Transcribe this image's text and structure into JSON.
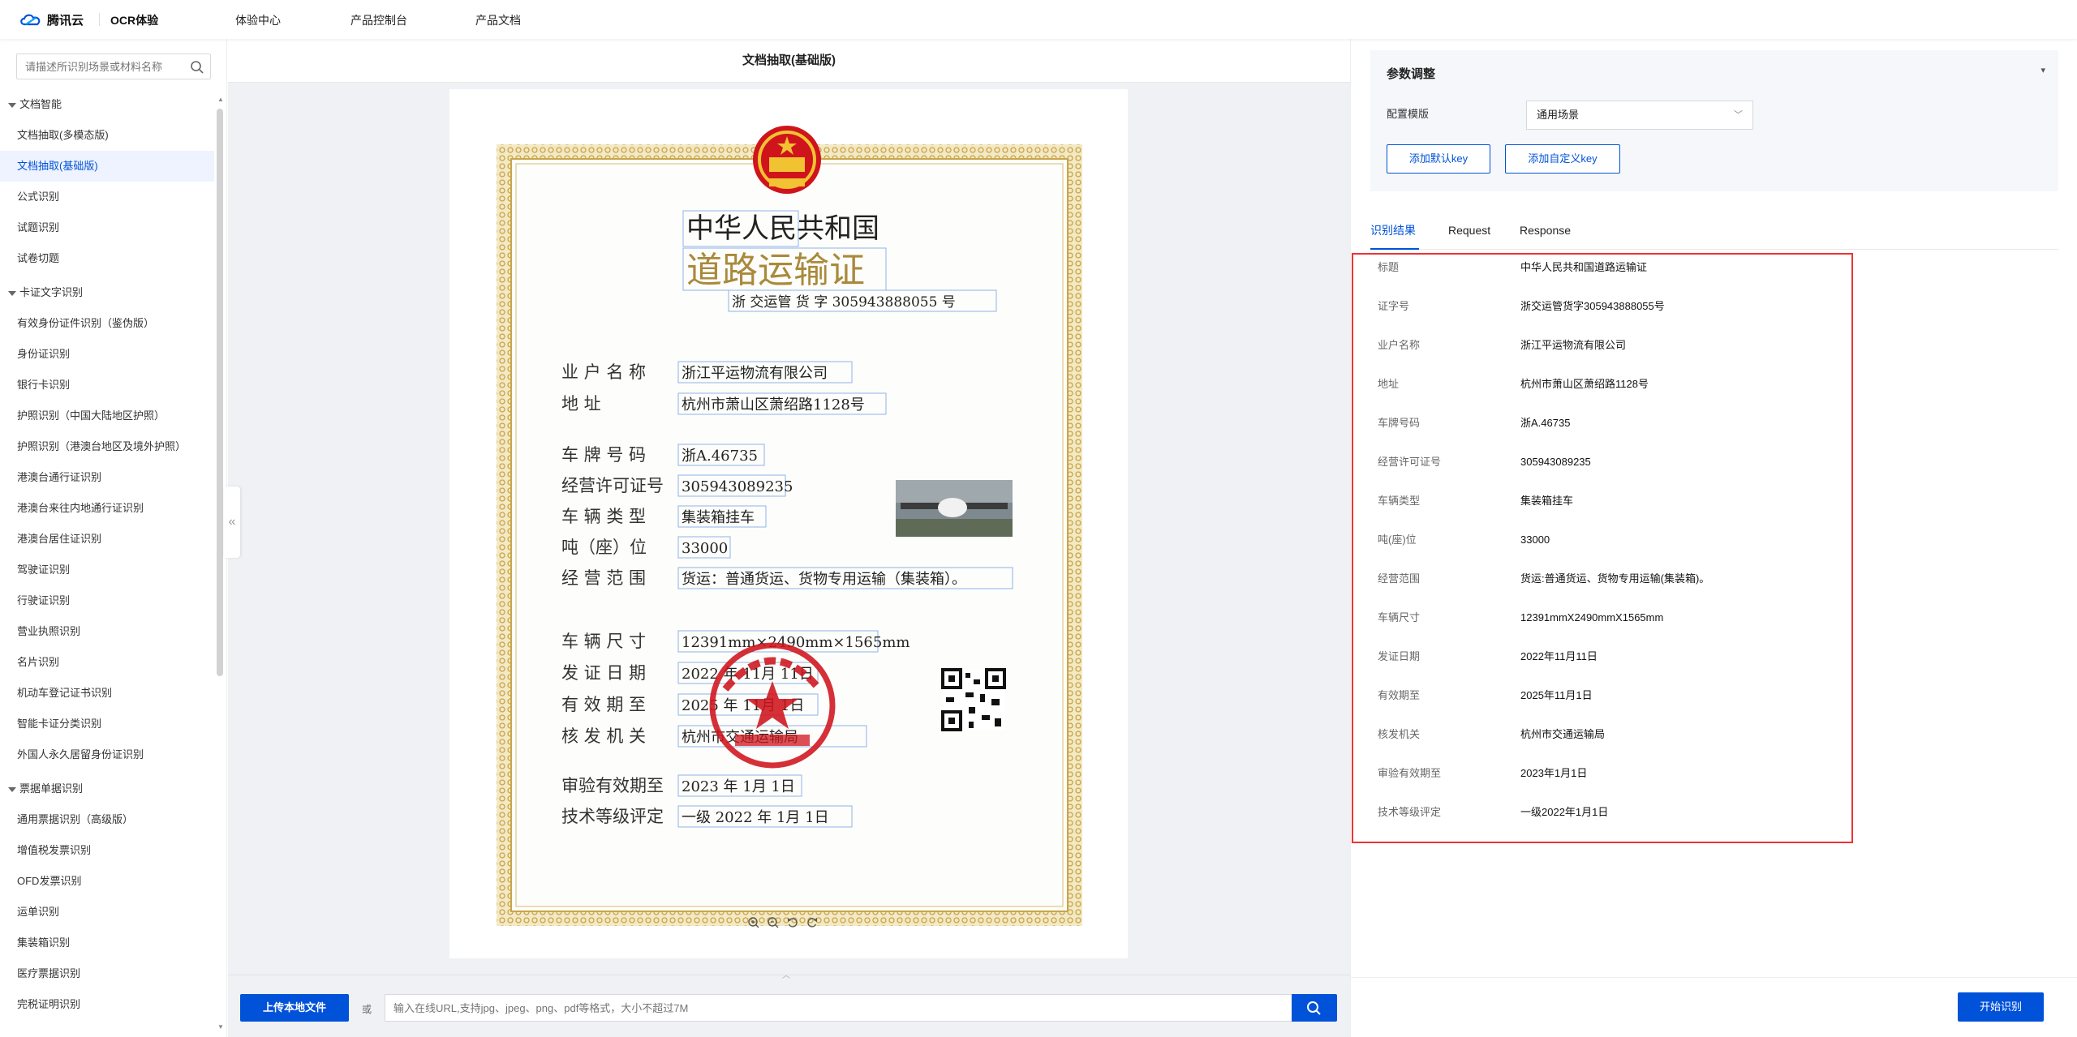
{
  "topbar": {
    "brand": "腾讯云",
    "product": "OCR体验",
    "nav": [
      "体验中心",
      "产品控制台",
      "产品文档"
    ]
  },
  "sidebar": {
    "search_placeholder": "请描述所识别场景或材料名称",
    "sections": [
      {
        "title": "文档智能",
        "items": [
          "文档抽取(多模态版)",
          "文档抽取(基础版)",
          "公式识别",
          "试题识别",
          "试卷切题"
        ]
      },
      {
        "title": "卡证文字识别",
        "items": [
          "有效身份证件识别（鉴伪版）",
          "身份证识别",
          "银行卡识别",
          "护照识别（中国大陆地区护照）",
          "护照识别（港澳台地区及境外护照）",
          "港澳台通行证识别",
          "港澳台来往内地通行证识别",
          "港澳台居住证识别",
          "驾驶证识别",
          "行驶证识别",
          "营业执照识别",
          "名片识别",
          "机动车登记证书识别",
          "智能卡证分类识别",
          "外国人永久居留身份证识别"
        ]
      },
      {
        "title": "票据单据识别",
        "items": [
          "通用票据识别（高级版）",
          "增值税发票识别",
          "OFD发票识别",
          "运单识别",
          "集装箱识别",
          "医疗票据识别",
          "完税证明识别"
        ]
      }
    ],
    "active_item": "文档抽取(基础版)"
  },
  "center": {
    "title": "文档抽取(基础版)",
    "upload_label": "上传本地文件",
    "or_label": "或",
    "url_placeholder": "输入在线URL,支持jpg、jpeg、png、pdf等格式，大小不超过7M"
  },
  "document": {
    "title_line1": "中华人民共和国",
    "title_line2": "道路运输证",
    "cert_no": "浙 交运管 货 字 305943888055 号",
    "fields": [
      {
        "label": "业 户 名 称",
        "value": "浙江平运物流有限公司"
      },
      {
        "label": "地         址",
        "value": "杭州市萧山区萧绍路1128号"
      },
      {
        "label": "车 牌 号 码",
        "value": "浙A.46735"
      },
      {
        "label": "经营许可证号",
        "value": "305943089235"
      },
      {
        "label": "车 辆 类 型",
        "value": "集装箱挂车"
      },
      {
        "label": "吨（座）位",
        "value": "33000"
      },
      {
        "label": "经 营 范 围",
        "value": "货运：普通货运、货物专用运输（集装箱）。"
      },
      {
        "label": "车 辆 尺 寸",
        "value": "12391mm×2490mm×1565mm"
      },
      {
        "label": "发 证 日 期",
        "value": "2022 年 11月 11日"
      },
      {
        "label": "有 效 期 至",
        "value": "2025 年 11月 1日"
      },
      {
        "label": "核 发 机 关",
        "value": "杭州市交通运输局"
      },
      {
        "label": "审验有效期至",
        "value": "2023 年  1月 1日"
      },
      {
        "label": "技术等级评定",
        "value": "一级    2022 年  1月  1日"
      }
    ],
    "seal_text": "杭州市交通运输局 道路运输证专用章"
  },
  "params": {
    "title": "参数调整",
    "template_label": "配置模版",
    "template_value": "通用场景",
    "btn_default_key": "添加默认key",
    "btn_custom_key": "添加自定义key"
  },
  "tabs": [
    "识别结果",
    "Request",
    "Response"
  ],
  "results": [
    {
      "key": "标题",
      "value": "中华人民共和国道路运输证"
    },
    {
      "key": "证字号",
      "value": "浙交运管货字305943888055号"
    },
    {
      "key": "业户名称",
      "value": "浙江平运物流有限公司"
    },
    {
      "key": "地址",
      "value": "杭州市萧山区萧绍路1128号"
    },
    {
      "key": "车牌号码",
      "value": "浙A.46735"
    },
    {
      "key": "经营许可证号",
      "value": "305943089235"
    },
    {
      "key": "车辆类型",
      "value": "集装箱挂车"
    },
    {
      "key": "吨(座)位",
      "value": "33000"
    },
    {
      "key": "经营范围",
      "value": "货运:普通货运、货物专用运输(集装箱)。"
    },
    {
      "key": "车辆尺寸",
      "value": "12391mmX2490mmX1565mm"
    },
    {
      "key": "发证日期",
      "value": "2022年11月11日"
    },
    {
      "key": "有效期至",
      "value": "2025年11月1日"
    },
    {
      "key": "核发机关",
      "value": "杭州市交通运输局"
    },
    {
      "key": "审验有效期至",
      "value": "2023年1月1日"
    },
    {
      "key": "技术等级评定",
      "value": "一级2022年1月1日"
    }
  ],
  "start_label": "开始识别",
  "colors": {
    "accent": "#0052d9",
    "highlight_border": "#e33333",
    "seal_red": "#d0141c",
    "frame_gold": "#c9a54a"
  }
}
